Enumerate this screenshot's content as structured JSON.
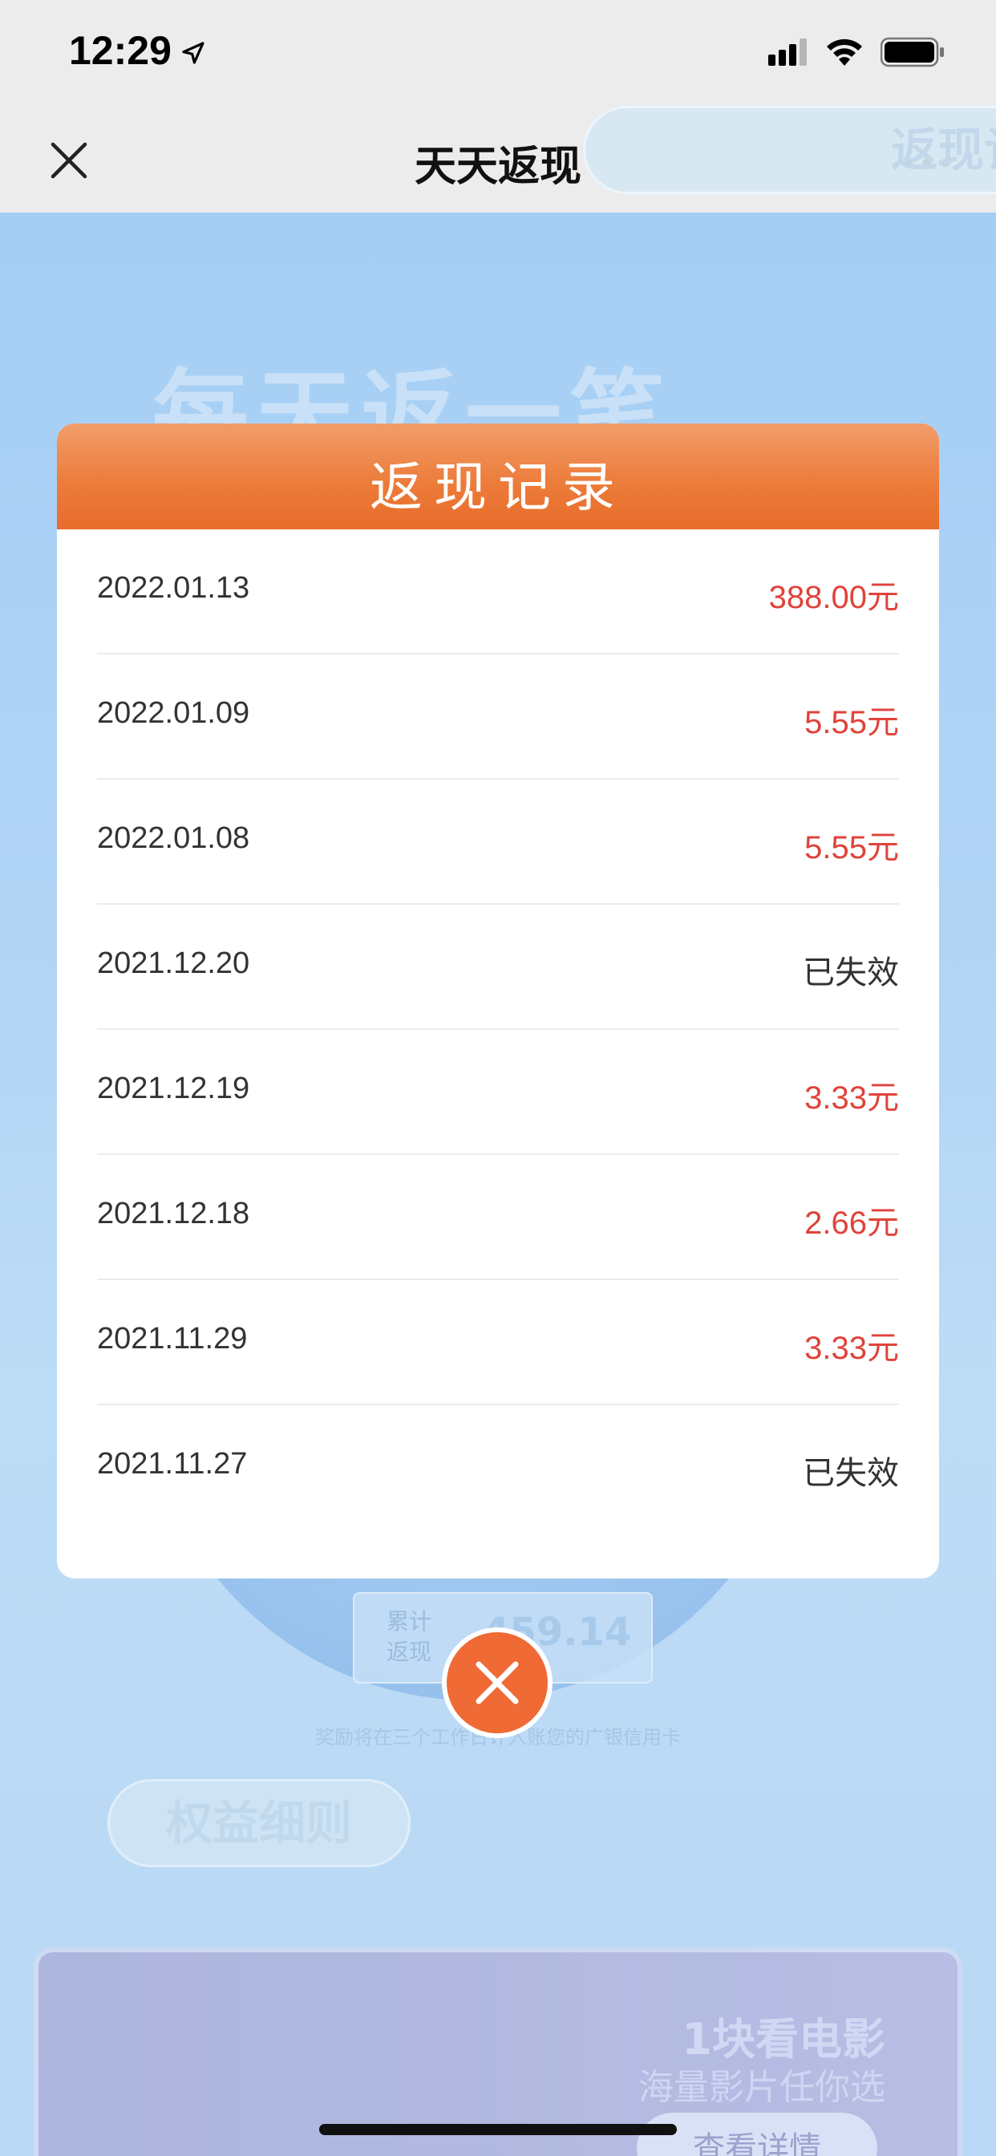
{
  "status_bar": {
    "time": "12:29"
  },
  "nav": {
    "title": "天天返现"
  },
  "background": {
    "heading": "每天返一笔",
    "total_label": "累计返现",
    "total_value": "459.14元",
    "note": "奖励将在三个工作日计入账您的广银信用卡",
    "button_rules": "权益细则",
    "button_records": "返现记录",
    "promo_title": "1块看电影",
    "promo_subtitle": "海量影片任你选",
    "promo_button": "查看详情"
  },
  "modal": {
    "title": "返现记录",
    "records": [
      {
        "date": "2022.01.13",
        "amount": "388.00元",
        "status": "valid"
      },
      {
        "date": "2022.01.09",
        "amount": "5.55元",
        "status": "valid"
      },
      {
        "date": "2022.01.08",
        "amount": "5.55元",
        "status": "valid"
      },
      {
        "date": "2021.12.20",
        "amount": "已失效",
        "status": "invalid"
      },
      {
        "date": "2021.12.19",
        "amount": "3.33元",
        "status": "valid"
      },
      {
        "date": "2021.12.18",
        "amount": "2.66元",
        "status": "valid"
      },
      {
        "date": "2021.11.29",
        "amount": "3.33元",
        "status": "valid"
      },
      {
        "date": "2021.11.27",
        "amount": "已失效",
        "status": "invalid"
      }
    ]
  },
  "colors": {
    "accent_orange": "#ec7a38",
    "amount_red": "#e0433a",
    "background_blue": "#9cc9f2"
  }
}
